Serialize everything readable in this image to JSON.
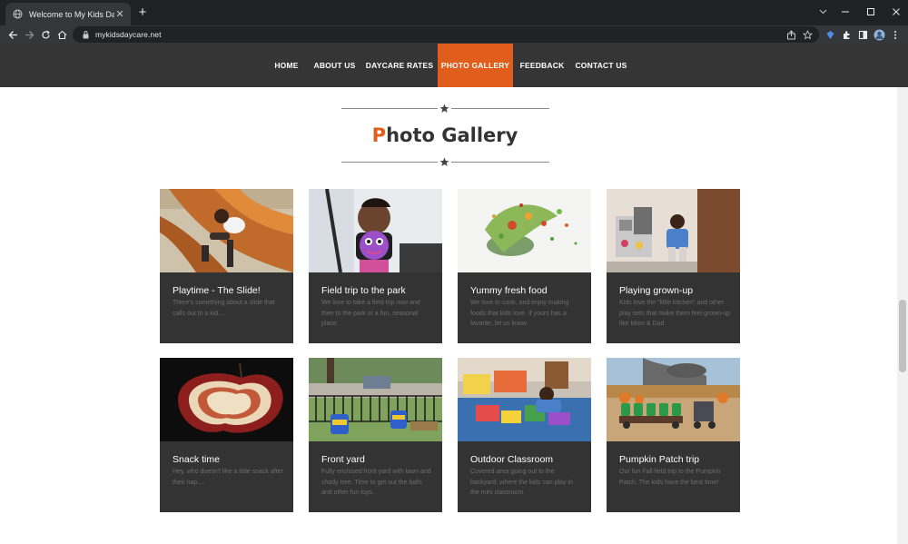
{
  "browser": {
    "tab_title": "Welcome to My Kids Daycare",
    "url": "mykidsdaycare.net"
  },
  "nav": {
    "items": [
      {
        "label": "HOME"
      },
      {
        "label": "ABOUT US"
      },
      {
        "label": "DAYCARE RATES"
      },
      {
        "label": "PHOTO GALLERY"
      },
      {
        "label": "FEEDBACK"
      },
      {
        "label": "CONTACT US"
      }
    ],
    "active_index": 3,
    "accent_color": "#e05d1c",
    "bar_color": "#353535"
  },
  "page": {
    "heading_first_letter": "P",
    "heading_rest": "hoto Gallery"
  },
  "gallery": [
    {
      "title": "Playtime - The Slide!",
      "description": "There's something about a slide that calls out to a kid...."
    },
    {
      "title": "Field trip to the park",
      "description": "We love to take a field trip now and then to the park or a fun, seasonal place."
    },
    {
      "title": "Yummy fresh food",
      "description": "We love to cook, and enjoy making foods that kids love. If yours has a favorite, let us know."
    },
    {
      "title": "Playing grown-up",
      "description": "Kids love the \"little kitchen\" and other play sets that make them feel grown-up like Mom & Dad."
    },
    {
      "title": "Snack time",
      "description": "Hey, who doesn't like a little snack after their nap...."
    },
    {
      "title": "Front yard",
      "description": "Fully enclosed front yard with lawn and shady tree. Time to get out the balls and other fun toys."
    },
    {
      "title": "Outdoor Classroom",
      "description": "Covered area going out to the backyard, where the kids can play in the mini classroom."
    },
    {
      "title": "Pumpkin Patch trip",
      "description": "Our fun Fall field trip to the Pumpkin Patch. The kids have the best time!"
    }
  ]
}
